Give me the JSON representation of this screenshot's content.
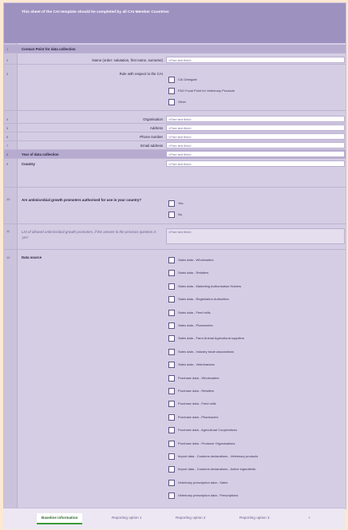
{
  "header": {
    "title": "This sheet of the CAI template should be completed by all CAI Member Countries"
  },
  "contact": {
    "num": "1",
    "heading": "Contact Point for data collection",
    "fields": [
      {
        "num": "2",
        "label": "Name (order: salutation, first name, surname)",
        "value": "<Free text field>"
      }
    ],
    "role": {
      "num": "3",
      "label": "Role with respect to the CAI",
      "options": [
        "CAI Delegate",
        "FAO Focal Point for Veterinary Products",
        "Other"
      ]
    },
    "more_fields": [
      {
        "num": "4",
        "label": "Organisation",
        "value": "<Free text field>"
      },
      {
        "num": "5",
        "label": "Address",
        "value": "<Free text field>"
      },
      {
        "num": "6",
        "label": "Phone number",
        "value": "<Free text field>"
      },
      {
        "num": "7",
        "label": "Email address",
        "value": "<Free text field>"
      }
    ]
  },
  "year": {
    "num": "8",
    "label": "Year of data collection",
    "value": "<Free text field>"
  },
  "country": {
    "num": "9",
    "label": "Country",
    "value": "<Free text field>"
  },
  "agp": {
    "num": "10",
    "label": "Are antimicrobial growth promoters authorised for use in your country?",
    "options": [
      "Yes",
      "No"
    ]
  },
  "agp_list": {
    "num": "11",
    "label": "List of allowed antimicrobial growth promoters, if the answer to the previous question is 'yes'",
    "value": "<Free text field>"
  },
  "source": {
    "num": "12",
    "label": "Data source",
    "options": [
      "Sales data - Wholesalers",
      "Sales data - Retailers",
      "Sales data - Marketing Authorisation Holders",
      "Sales data - Registration Authorities",
      "Sales data - Feed mills",
      "Sales data - Pharmacies",
      "Sales data - Farm Animal Agricultural suppliers",
      "Sales data - Industry trade associations",
      "Sales data - Veterinarians",
      "Purchase data - Wholesalers",
      "Purchase data - Retailers",
      "Purchase data - Feed mills",
      "Purchase data - Pharmacies",
      "Purchase data - Agricultural Cooperatives",
      "Purchase data - Producer Organisations",
      "Import data - Customs declarations - Veterinary products",
      "Import data - Customs declarations - Active ingredients",
      "Veterinary prescription data - Sales",
      "Veterinary prescription data - Prescriptions"
    ]
  },
  "tabs": [
    "Baseline information",
    "Reporting option 1",
    "Reporting option 2",
    "Reporting option 3",
    "+"
  ]
}
